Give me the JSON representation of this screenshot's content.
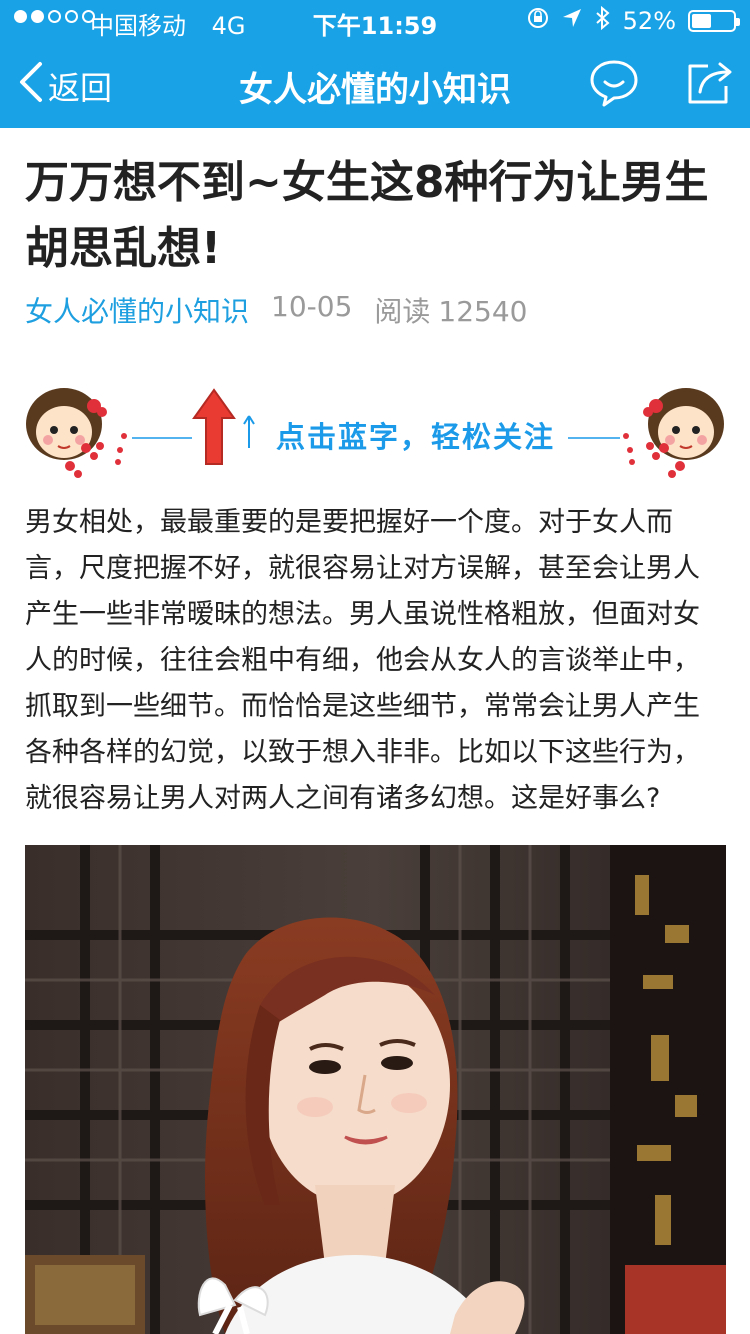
{
  "status_bar": {
    "carrier": "中国移动",
    "network": "4G",
    "time": "下午11:59",
    "battery_percent": "52%",
    "battery_level": 0.52
  },
  "nav": {
    "back_label": "返回",
    "title": "女人必懂的小知识",
    "color": "#1aa2e6"
  },
  "article": {
    "title": "万万想不到~女生这8种行为让男生胡思乱想!",
    "source": "女人必懂的小知识",
    "date": "10-05",
    "reads_label": "阅读",
    "reads_count": "12540",
    "follow_text": "点击蓝字，轻松关注",
    "paragraph": "男女相处，最最重要的是要把握好一个度。对于女人而言，尺度把握不好，就很容易让对方误解，甚至会让男人产生一些非常暧昧的想法。男人虽说性格粗放，但面对女人的时候，往往会粗中有细，他会从女人的言谈举止中，抓取到一些细节。而恰恰是这些细节，常常会让男人产生各种各样的幻觉，以致于想入非非。比如以下这些行为，就很容易让男人对两人之间有诸多幻想。这是好事么?"
  },
  "icons": {
    "back": "chevron-left-icon",
    "comment": "comment-bubble-icon",
    "share": "share-icon",
    "location": "location-arrow-icon",
    "bluetooth": "bluetooth-icon",
    "lock_rotation": "orientation-lock-icon"
  }
}
